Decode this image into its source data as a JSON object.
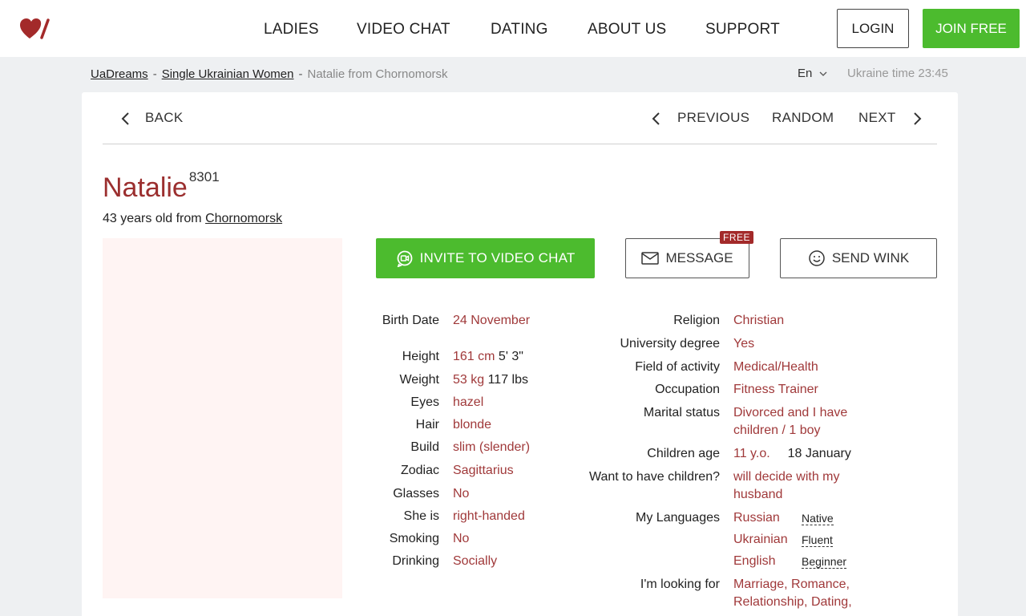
{
  "header": {
    "nav": [
      "LADIES",
      "VIDEO CHAT",
      "DATING",
      "ABOUT US",
      "SUPPORT"
    ],
    "login_label": "LOGIN",
    "join_label": "JOIN FREE"
  },
  "breadcrumb": {
    "items": [
      "UaDreams",
      "Single Ukrainian Women"
    ],
    "current": "Natalie from Chornomorsk",
    "separator": "-"
  },
  "language": "En",
  "ukraine_time": "Ukraine time 23:45",
  "card_nav": {
    "back": "BACK",
    "previous": "PREVIOUS",
    "random": "RANDOM",
    "next": "NEXT"
  },
  "profile": {
    "name": "Natalie",
    "id": "8301",
    "subline_prefix": "43 years old from",
    "city": "Chornomorsk"
  },
  "actions": {
    "video_chat": "INVITE TO VIDEO CHAT",
    "message": "MESSAGE",
    "free_badge": "FREE",
    "wink": "SEND WINK"
  },
  "details_left": [
    {
      "label": "Birth Date",
      "value": "24 November"
    },
    {
      "label": "Height",
      "value": "161 cm",
      "extra": "5' 3\""
    },
    {
      "label": "Weight",
      "value": "53 kg",
      "extra": "117 lbs"
    },
    {
      "label": "Eyes",
      "value": "hazel"
    },
    {
      "label": "Hair",
      "value": "blonde"
    },
    {
      "label": "Build",
      "value": "slim (slender)"
    },
    {
      "label": "Zodiac",
      "value": "Sagittarius"
    },
    {
      "label": "Glasses",
      "value": "No"
    },
    {
      "label": "She is",
      "value": "right-handed"
    },
    {
      "label": "Smoking",
      "value": "No"
    },
    {
      "label": "Drinking",
      "value": "Socially"
    }
  ],
  "details_right": {
    "religion": {
      "label": "Religion",
      "value": "Christian"
    },
    "university": {
      "label": "University degree",
      "value": "Yes"
    },
    "field": {
      "label": "Field of activity",
      "value": "Medical/Health"
    },
    "occupation": {
      "label": "Occupation",
      "value": "Fitness Trainer"
    },
    "marital": {
      "label": "Marital status",
      "value_line1": "Divorced and I have",
      "value_line2": "children / 1 boy"
    },
    "children_age": {
      "label": "Children age",
      "value": "11 y.o.",
      "extra": "18 January"
    },
    "want_children": {
      "label": "Want to have children?",
      "value_line1": "will decide with my",
      "value_line2": "husband"
    },
    "languages": {
      "label": "My Languages",
      "items": [
        {
          "name": "Russian",
          "level": "Native"
        },
        {
          "name": "Ukrainian",
          "level": "Fluent"
        },
        {
          "name": "English",
          "level": "Beginner"
        }
      ]
    },
    "looking_for": {
      "label": "I'm looking for",
      "value_line1": "Marriage, Romance,",
      "value_line2": "Relationship, Dating,"
    }
  },
  "colors": {
    "accent_green": "#4cbb2e",
    "accent_red": "#a0393a",
    "name_red": "#9b2f2f"
  }
}
